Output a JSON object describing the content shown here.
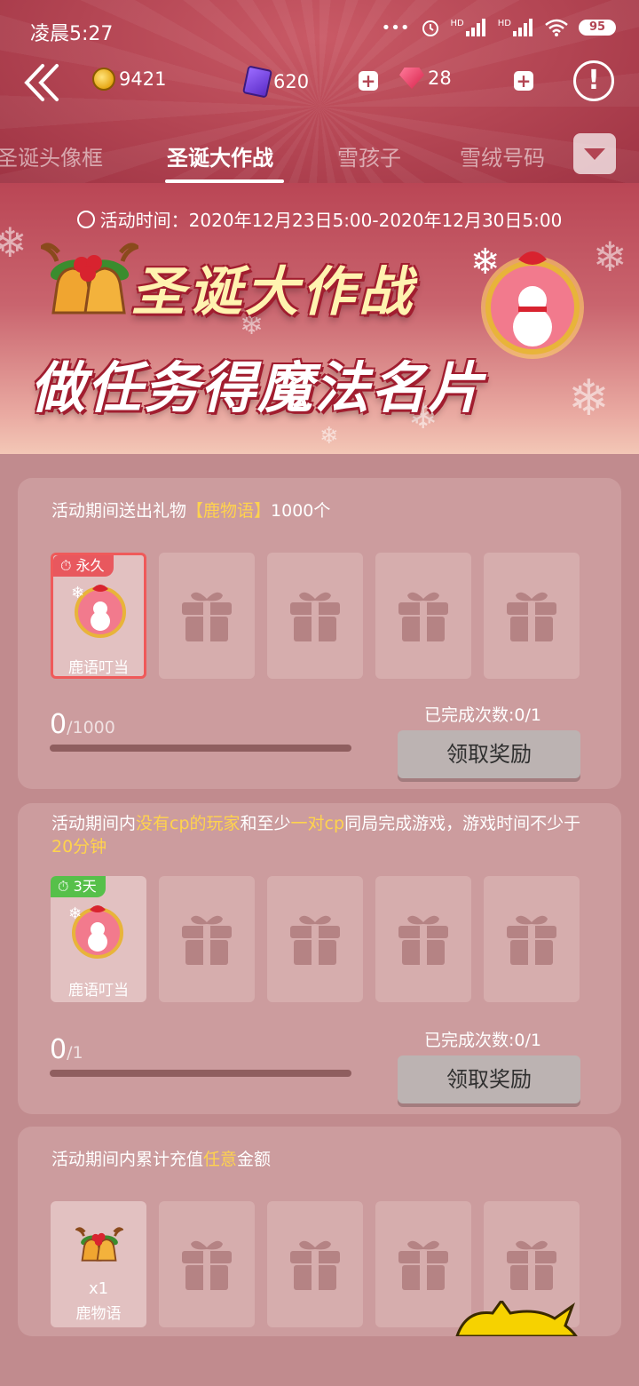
{
  "status_bar": {
    "time": "凌晨5:27",
    "dots": "•••",
    "signal_1": "HD",
    "signal_2": "HD",
    "battery": "95"
  },
  "topbar": {
    "coins": "9421",
    "cards": "620",
    "gems": "28",
    "plus_label": "+",
    "info_label": "!"
  },
  "tabs": [
    {
      "label": "圣诞头像框"
    },
    {
      "label": "圣诞大作战"
    },
    {
      "label": "雪孩子"
    },
    {
      "label": "雪绒号码"
    }
  ],
  "banner": {
    "activity_time": "活动时间：2020年12月23日5:00-2020年12月30日5:00",
    "title": "圣诞大作战",
    "subtitle": "做任务得魔法名片"
  },
  "tasks": [
    {
      "desc_pre": "活动期间送出礼物",
      "desc_hl": "【鹿物语】",
      "desc_post": "1000个",
      "badge": "永久",
      "reward_name": "鹿语叮当",
      "progress_cur": "0",
      "progress_total": "/1000",
      "progress_fraction": 0,
      "complete_count": "已完成次数:0/1",
      "claim_label": "领取奖励"
    },
    {
      "desc_1": "活动期间内",
      "desc_hl1": "没有cp的玩家",
      "desc_2": "和至少",
      "desc_hl2": "一对cp",
      "desc_3": "同局完成游戏，游戏时间不少于",
      "desc_hl3": "20分钟",
      "badge": "3天",
      "reward_name": "鹿语叮当",
      "progress_cur": "0",
      "progress_total": "/1",
      "progress_fraction": 0,
      "complete_count": "已完成次数:0/1",
      "claim_label": "领取奖励"
    },
    {
      "desc_pre": "活动期间内累计充值",
      "desc_hl": "任意",
      "desc_post": "金额",
      "reward_qty": "x1",
      "reward_name": "鹿物语"
    }
  ],
  "colors": {
    "accent": "#ffd34d",
    "header": "#b24452",
    "card": "#cc9c9e"
  }
}
